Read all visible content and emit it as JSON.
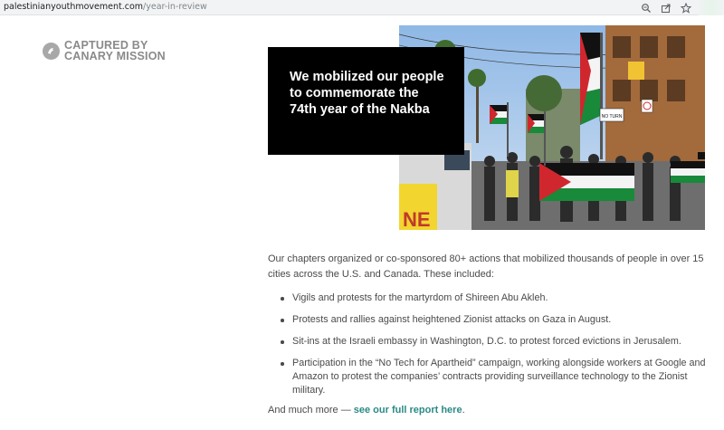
{
  "browser": {
    "url_domain": "palestinianyouthmovement.com",
    "url_path": "/year-in-review"
  },
  "watermark": {
    "line1": "CAPTURED BY",
    "line2": "CANARY MISSION"
  },
  "hero": {
    "title": "We mobilized our people to commemorate the 74th year of the Nakba"
  },
  "content": {
    "intro": "Our chapters organized or co-sponsored 80+ actions that mobilized thousands of people in over 15 cities across the U.S. and Canada. These included:",
    "bullets": [
      "Vigils and protests for the martyrdom of Shireen Abu Akleh.",
      "Protests and rallies against heightened Zionist attacks on Gaza in August.",
      "Sit-ins at the Israeli embassy in Washington, D.C. to protest forced evictions in Jerusalem.",
      "Participation in the “No Tech for Apartheid” campaign, working alongside workers at Google and Amazon to protest the companies’ contracts providing surveillance technology to the Zionist military."
    ],
    "more_prefix": "And much more — ",
    "more_link": "see our full report here",
    "more_suffix": "."
  },
  "photo_sign": "NO TURN"
}
